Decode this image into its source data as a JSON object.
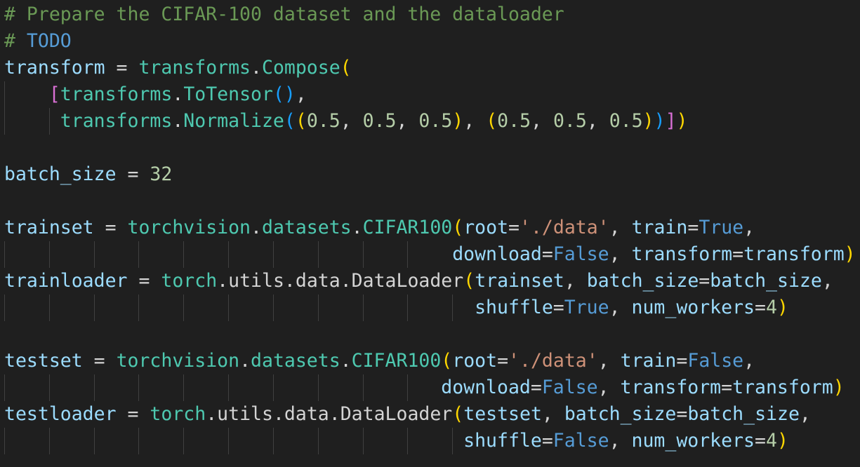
{
  "editor": {
    "language": "python",
    "colors": {
      "background": "#1f1f1f",
      "comment": "#6a9955",
      "variable": "#9cdcfe",
      "class": "#4ec9b0",
      "number": "#b5cea8",
      "string": "#ce9178",
      "keyword": "#569cd6",
      "plain": "#d4d4d4",
      "bracket_level_1": "#ffd700",
      "bracket_level_2": "#da70d6",
      "bracket_level_3": "#179fff",
      "indent_guide": "#404040"
    },
    "lines": [
      [
        {
          "t": "# Prepare the CIFAR-100 dataset and the dataloader",
          "c": "comment"
        }
      ],
      [
        {
          "t": "# ",
          "c": "comment"
        },
        {
          "t": "TODO",
          "c": "kw"
        }
      ],
      [
        {
          "t": "transform",
          "c": "var"
        },
        {
          "t": " = ",
          "c": "op"
        },
        {
          "t": "transforms",
          "c": "mod"
        },
        {
          "t": ".",
          "c": "plain"
        },
        {
          "t": "Compose",
          "c": "cls"
        },
        {
          "t": "(",
          "c": "b1"
        }
      ],
      [
        {
          "t": "    ",
          "c": "plain"
        },
        {
          "t": "[",
          "c": "b2"
        },
        {
          "t": "transforms",
          "c": "mod"
        },
        {
          "t": ".",
          "c": "plain"
        },
        {
          "t": "ToTensor",
          "c": "cls"
        },
        {
          "t": "()",
          "c": "b3"
        },
        {
          "t": ",",
          "c": "plain"
        }
      ],
      [
        {
          "t": "     ",
          "c": "plain"
        },
        {
          "t": "transforms",
          "c": "mod"
        },
        {
          "t": ".",
          "c": "plain"
        },
        {
          "t": "Normalize",
          "c": "cls"
        },
        {
          "t": "(",
          "c": "b3"
        },
        {
          "t": "(",
          "c": "b1"
        },
        {
          "t": "0.5",
          "c": "num"
        },
        {
          "t": ", ",
          "c": "plain"
        },
        {
          "t": "0.5",
          "c": "num"
        },
        {
          "t": ", ",
          "c": "plain"
        },
        {
          "t": "0.5",
          "c": "num"
        },
        {
          "t": ")",
          "c": "b1"
        },
        {
          "t": ", ",
          "c": "plain"
        },
        {
          "t": "(",
          "c": "b1"
        },
        {
          "t": "0.5",
          "c": "num"
        },
        {
          "t": ", ",
          "c": "plain"
        },
        {
          "t": "0.5",
          "c": "num"
        },
        {
          "t": ", ",
          "c": "plain"
        },
        {
          "t": "0.5",
          "c": "num"
        },
        {
          "t": ")",
          "c": "b1"
        },
        {
          "t": ")",
          "c": "b3"
        },
        {
          "t": "]",
          "c": "b2"
        },
        {
          "t": ")",
          "c": "b1"
        }
      ],
      [],
      [
        {
          "t": "batch_size",
          "c": "var"
        },
        {
          "t": " = ",
          "c": "op"
        },
        {
          "t": "32",
          "c": "num"
        }
      ],
      [],
      [
        {
          "t": "trainset",
          "c": "var"
        },
        {
          "t": " = ",
          "c": "op"
        },
        {
          "t": "torchvision",
          "c": "mod"
        },
        {
          "t": ".",
          "c": "plain"
        },
        {
          "t": "datasets",
          "c": "mod"
        },
        {
          "t": ".",
          "c": "plain"
        },
        {
          "t": "CIFAR100",
          "c": "cls"
        },
        {
          "t": "(",
          "c": "b1"
        },
        {
          "t": "root",
          "c": "var"
        },
        {
          "t": "=",
          "c": "op"
        },
        {
          "t": "'./data'",
          "c": "str"
        },
        {
          "t": ", ",
          "c": "plain"
        },
        {
          "t": "train",
          "c": "var"
        },
        {
          "t": "=",
          "c": "op"
        },
        {
          "t": "True",
          "c": "kw"
        },
        {
          "t": ",",
          "c": "plain"
        }
      ],
      [
        {
          "t": "                                        ",
          "c": "plain"
        },
        {
          "t": "download",
          "c": "var"
        },
        {
          "t": "=",
          "c": "op"
        },
        {
          "t": "False",
          "c": "kw"
        },
        {
          "t": ", ",
          "c": "plain"
        },
        {
          "t": "transform",
          "c": "var"
        },
        {
          "t": "=",
          "c": "op"
        },
        {
          "t": "transform",
          "c": "var"
        },
        {
          "t": ")",
          "c": "b1"
        }
      ],
      [
        {
          "t": "trainloader",
          "c": "var"
        },
        {
          "t": " = ",
          "c": "op"
        },
        {
          "t": "torch",
          "c": "mod"
        },
        {
          "t": ".",
          "c": "plain"
        },
        {
          "t": "utils",
          "c": "plain"
        },
        {
          "t": ".",
          "c": "plain"
        },
        {
          "t": "data",
          "c": "plain"
        },
        {
          "t": ".",
          "c": "plain"
        },
        {
          "t": "DataLoader",
          "c": "plain"
        },
        {
          "t": "(",
          "c": "b1"
        },
        {
          "t": "trainset",
          "c": "var"
        },
        {
          "t": ", ",
          "c": "plain"
        },
        {
          "t": "batch_size",
          "c": "var"
        },
        {
          "t": "=",
          "c": "op"
        },
        {
          "t": "batch_size",
          "c": "var"
        },
        {
          "t": ",",
          "c": "plain"
        }
      ],
      [
        {
          "t": "                                          ",
          "c": "plain"
        },
        {
          "t": "shuffle",
          "c": "var"
        },
        {
          "t": "=",
          "c": "op"
        },
        {
          "t": "True",
          "c": "kw"
        },
        {
          "t": ", ",
          "c": "plain"
        },
        {
          "t": "num_workers",
          "c": "var"
        },
        {
          "t": "=",
          "c": "op"
        },
        {
          "t": "4",
          "c": "num"
        },
        {
          "t": ")",
          "c": "b1"
        }
      ],
      [],
      [
        {
          "t": "testset",
          "c": "var"
        },
        {
          "t": " = ",
          "c": "op"
        },
        {
          "t": "torchvision",
          "c": "mod"
        },
        {
          "t": ".",
          "c": "plain"
        },
        {
          "t": "datasets",
          "c": "mod"
        },
        {
          "t": ".",
          "c": "plain"
        },
        {
          "t": "CIFAR100",
          "c": "cls"
        },
        {
          "t": "(",
          "c": "b1"
        },
        {
          "t": "root",
          "c": "var"
        },
        {
          "t": "=",
          "c": "op"
        },
        {
          "t": "'./data'",
          "c": "str"
        },
        {
          "t": ", ",
          "c": "plain"
        },
        {
          "t": "train",
          "c": "var"
        },
        {
          "t": "=",
          "c": "op"
        },
        {
          "t": "False",
          "c": "kw"
        },
        {
          "t": ",",
          "c": "plain"
        }
      ],
      [
        {
          "t": "                                       ",
          "c": "plain"
        },
        {
          "t": "download",
          "c": "var"
        },
        {
          "t": "=",
          "c": "op"
        },
        {
          "t": "False",
          "c": "kw"
        },
        {
          "t": ", ",
          "c": "plain"
        },
        {
          "t": "transform",
          "c": "var"
        },
        {
          "t": "=",
          "c": "op"
        },
        {
          "t": "transform",
          "c": "var"
        },
        {
          "t": ")",
          "c": "b1"
        }
      ],
      [
        {
          "t": "testloader",
          "c": "var"
        },
        {
          "t": " = ",
          "c": "op"
        },
        {
          "t": "torch",
          "c": "mod"
        },
        {
          "t": ".",
          "c": "plain"
        },
        {
          "t": "utils",
          "c": "plain"
        },
        {
          "t": ".",
          "c": "plain"
        },
        {
          "t": "data",
          "c": "plain"
        },
        {
          "t": ".",
          "c": "plain"
        },
        {
          "t": "DataLoader",
          "c": "plain"
        },
        {
          "t": "(",
          "c": "b1"
        },
        {
          "t": "testset",
          "c": "var"
        },
        {
          "t": ", ",
          "c": "plain"
        },
        {
          "t": "batch_size",
          "c": "var"
        },
        {
          "t": "=",
          "c": "op"
        },
        {
          "t": "batch_size",
          "c": "var"
        },
        {
          "t": ",",
          "c": "plain"
        }
      ],
      [
        {
          "t": "                                         ",
          "c": "plain"
        },
        {
          "t": "shuffle",
          "c": "var"
        },
        {
          "t": "=",
          "c": "op"
        },
        {
          "t": "False",
          "c": "kw"
        },
        {
          "t": ", ",
          "c": "plain"
        },
        {
          "t": "num_workers",
          "c": "var"
        },
        {
          "t": "=",
          "c": "op"
        },
        {
          "t": "4",
          "c": "num"
        },
        {
          "t": ")",
          "c": "b1"
        }
      ]
    ]
  }
}
